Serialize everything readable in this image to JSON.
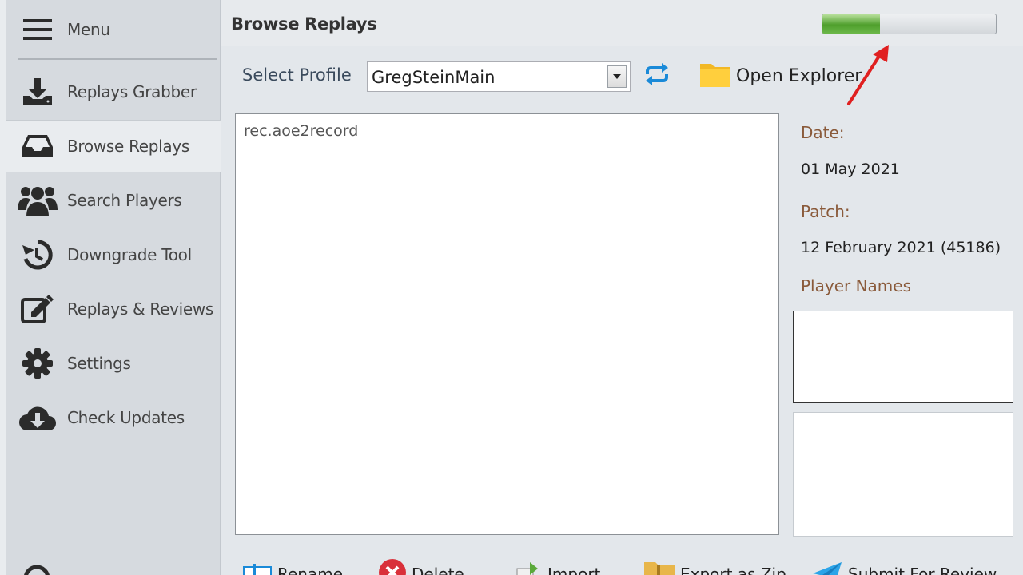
{
  "sidebar": {
    "menu_label": "Menu",
    "items": [
      {
        "label": "Replays Grabber",
        "icon": "download-icon"
      },
      {
        "label": "Browse Replays",
        "icon": "inbox-icon",
        "active": true
      },
      {
        "label": "Search Players",
        "icon": "users-icon"
      },
      {
        "label": "Downgrade Tool",
        "icon": "history-icon"
      },
      {
        "label": "Replays & Reviews",
        "icon": "edit-icon"
      },
      {
        "label": "Settings",
        "icon": "gear-icon"
      },
      {
        "label": "Check Updates",
        "icon": "cloud-download-icon"
      }
    ]
  },
  "header": {
    "title": "Browse Replays",
    "progress": 0.33
  },
  "profile": {
    "label": "Select Profile",
    "selected": "GregSteinMain",
    "open_explorer": "Open Explorer"
  },
  "files": [
    "rec.aoe2record"
  ],
  "details": {
    "date_label": "Date:",
    "date_value": "01 May 2021",
    "patch_label": "Patch:",
    "patch_value": "12 February 2021 (45186)",
    "players_label": "Player Names"
  },
  "toolbar": {
    "rename": "Rename",
    "delete": "Delete",
    "import": "Import",
    "export_zip": "Export as Zip",
    "submit_review": "Submit For Review"
  },
  "colors": {
    "accent_blue": "#1a8ad8",
    "annotation_red": "#e02020",
    "progress_green": "#4f9f2c",
    "label_brown": "#8a5a3a"
  }
}
